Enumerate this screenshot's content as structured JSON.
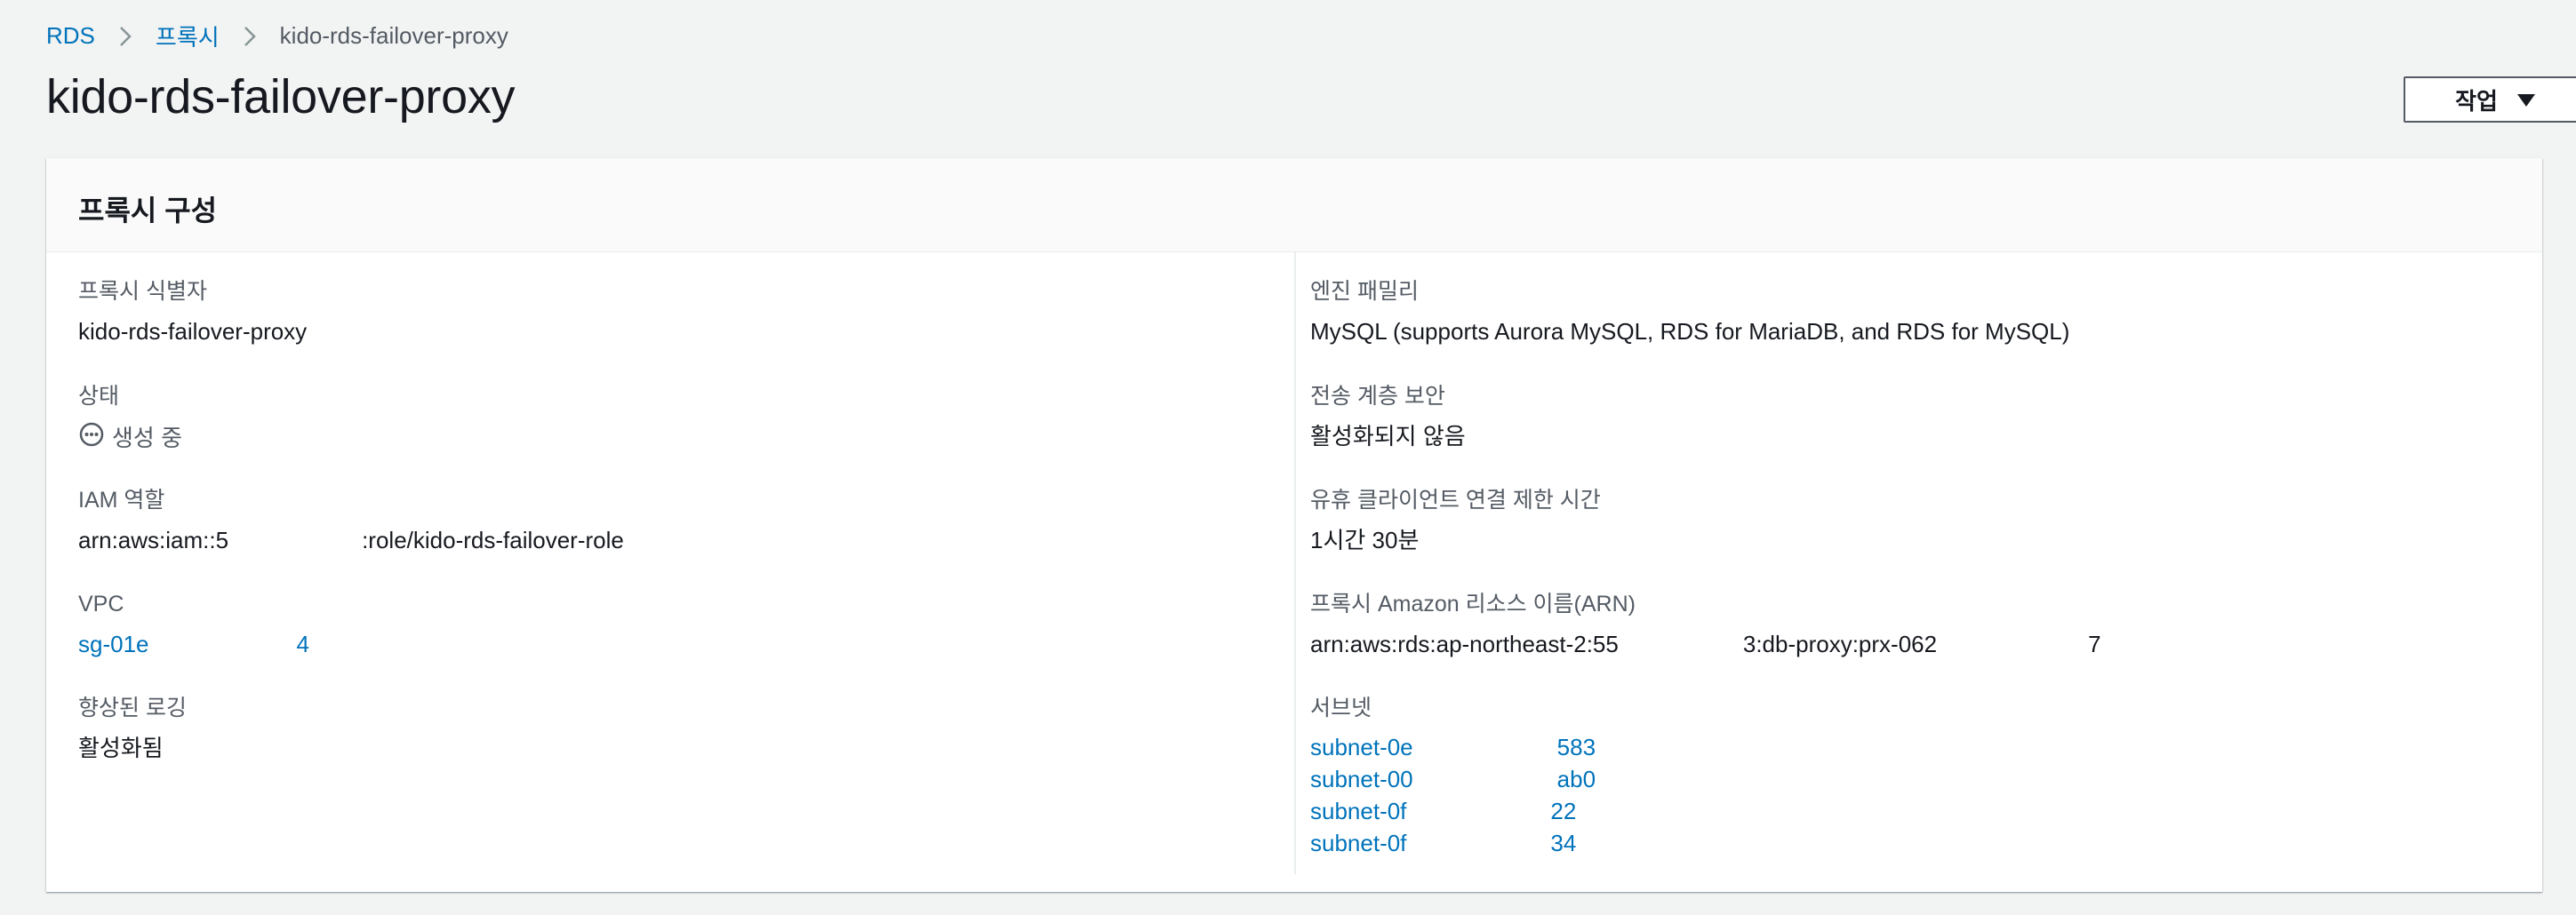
{
  "breadcrumb": {
    "items": [
      "RDS",
      "프록시"
    ],
    "current": "kido-rds-failover-proxy"
  },
  "page": {
    "title": "kido-rds-failover-proxy",
    "actions_label": "작업"
  },
  "panel": {
    "title": "프록시 구성",
    "left": {
      "identifier": {
        "label": "프록시 식별자",
        "value": "kido-rds-failover-proxy"
      },
      "status": {
        "label": "상태",
        "value": "생성 중",
        "icon": "pending-icon"
      },
      "iam_role": {
        "label": "IAM 역할",
        "value_start": "arn:aws:iam::5",
        "value_end": ":role/kido-rds-failover-role"
      },
      "vpc": {
        "label": "VPC",
        "value_start": "sg-01e",
        "value_end": "4"
      },
      "enhanced_logging": {
        "label": "향상된 로깅",
        "value": "활성화됨"
      }
    },
    "right": {
      "engine_family": {
        "label": "엔진 패밀리",
        "value": "MySQL (supports Aurora MySQL, RDS for MariaDB, and RDS for MySQL)"
      },
      "tls": {
        "label": "전송 계층 보안",
        "value": "활성화되지 않음"
      },
      "idle_timeout": {
        "label": "유휴 클라이언트 연결 제한 시간",
        "value": "1시간 30분"
      },
      "arn": {
        "label": "프록시 Amazon 리소스 이름(ARN)",
        "value_start": "arn:aws:rds:ap-northeast-2:55",
        "value_mid": "3:db-proxy:prx-062",
        "value_end": "7"
      },
      "subnets": {
        "label": "서브넷",
        "items": [
          {
            "start": "subnet-0e",
            "end": "583"
          },
          {
            "start": "subnet-00",
            "end": "ab0"
          },
          {
            "start": "subnet-0f",
            "end": "22"
          },
          {
            "start": "subnet-0f",
            "end": "34"
          }
        ]
      }
    }
  }
}
